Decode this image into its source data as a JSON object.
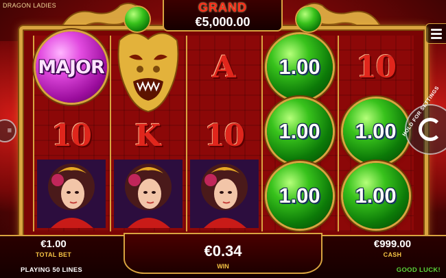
{
  "game": {
    "title": "DRAGON LADIES"
  },
  "jackpot": {
    "label": "GRAND",
    "amount": "€5,000.00"
  },
  "reels": {
    "reel1": {
      "row1": "MAJOR",
      "row2": "10",
      "row3": "lady"
    },
    "reel2": {
      "row1": "dragon",
      "row2": "K",
      "row3": "lady"
    },
    "reel3": {
      "row1": "A",
      "row2": "10",
      "row3": "lady"
    },
    "reel4": {
      "row1": "1.00",
      "row2": "1.00",
      "row3": "1.00"
    },
    "reel5": {
      "row1": "10",
      "row2": "1.00",
      "row3": "1.00"
    }
  },
  "controls": {
    "hold_label": "HOLD FOR SETTINGS",
    "left_label": "≡"
  },
  "footer": {
    "total_bet_value": "€1.00",
    "total_bet_label": "TOTAL BET",
    "win_value": "€0.34",
    "win_label": "WIN",
    "cash_value": "€999.00",
    "cash_label": "CASH",
    "lines_text": "PLAYING 50 LINES",
    "status_text": "GOOD LUCK!"
  },
  "colors": {
    "gold": "#d9a440",
    "orb_green": "#38c21c",
    "major_pink": "#e24be0",
    "status_green": "#5bd33a",
    "label_yellow": "#f6c445"
  }
}
